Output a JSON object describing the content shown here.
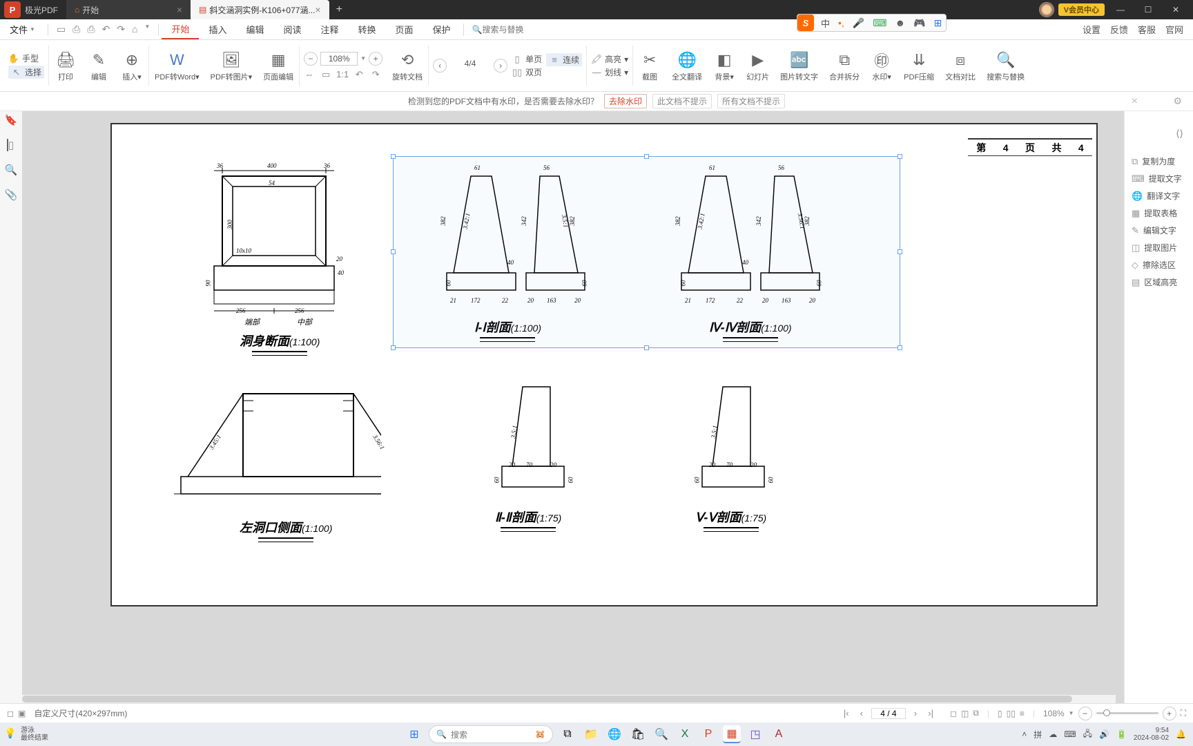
{
  "app_name": "极光PDF",
  "tabs": {
    "home_label": "开始",
    "doc_label": "斜交涵洞实例-K106+077涵..."
  },
  "vip_button": "V会员中心",
  "file_button": "文件",
  "menu": {
    "items": [
      "开始",
      "插入",
      "编辑",
      "阅读",
      "注释",
      "转换",
      "页面",
      "保护"
    ],
    "active": "开始",
    "search_placeholder": "搜索与替换",
    "right_items": [
      "设置",
      "反馈",
      "客服",
      "官网"
    ]
  },
  "ribbon": {
    "hand": "手型",
    "select": "选择",
    "print": "打印",
    "edit": "编辑",
    "insert": "插入",
    "pdf2word": "PDF转Word",
    "pdf2img": "PDF转图片",
    "page_edit": "页面编辑",
    "zoom_value": "108%",
    "page_value": "4/4",
    "rotate": "旋转文档",
    "single_page": "单页",
    "two_page": "双页",
    "continuous": "连续",
    "highlight": "高亮",
    "line": "划线",
    "screenshot": "截图",
    "fulltext_trans": "全文翻译",
    "background": "背景",
    "slideshow": "幻灯片",
    "img2text": "图片转文字",
    "merge_split": "合并拆分",
    "watermark": "水印",
    "pdf_compress": "PDF压缩",
    "doc_compare": "文档对比",
    "search_replace": "搜索与替换"
  },
  "notif": {
    "message": "检测到您的PDF文档中有水印，是否需要去除水印？",
    "action_remove": "去除水印",
    "action_hide_this": "此文档不提示",
    "action_hide_all": "所有文档不提示"
  },
  "right_panel": {
    "items": [
      {
        "icon": "⧉",
        "label": "复制为度"
      },
      {
        "icon": "⌨",
        "label": "提取文字"
      },
      {
        "icon": "🌐",
        "label": "翻译文字"
      },
      {
        "icon": "▦",
        "label": "提取表格"
      },
      {
        "icon": "✎",
        "label": "编辑文字"
      },
      {
        "icon": "◫",
        "label": "提取图片"
      },
      {
        "icon": "◇",
        "label": "擦除选区"
      },
      {
        "icon": "▤",
        "label": "区域高亮"
      }
    ]
  },
  "status": {
    "page_size": "自定义尺寸(420×297mm)",
    "page_nav": "4 / 4",
    "zoom_label": "108%"
  },
  "taskbar": {
    "assistant_title": "游泳",
    "assistant_sub": "最终结果",
    "search_placeholder": "搜索",
    "time": "9:54",
    "date": "2024-08-02"
  },
  "drawings": {
    "sec1": {
      "title": "洞身断面",
      "scale": "(1:100)",
      "dims": {
        "w_top": "400",
        "w_flange": "36",
        "h_inner": "300",
        "w_base_l": "256",
        "w_base_r": "256",
        "h_base": "90",
        "fillet": "10x10",
        "label_l": "端部",
        "label_r": "中部",
        "tf_r": "20",
        "top_thk": "54",
        "jog": "40"
      }
    },
    "sec2": {
      "title": "左洞口侧面",
      "scale": "(1:100)",
      "slope_l": "3.45:1",
      "slope_r": "3.56:1"
    },
    "sec3": {
      "title": "Ⅰ-Ⅰ剖面",
      "scale": "(1:100)",
      "dims": {
        "top_l": "61",
        "top_r": "56",
        "h": "342",
        "side_h": "382",
        "slope_l": "3.42:1",
        "slope_r": "3.5:1",
        "base_h": "60",
        "b1": "21",
        "b2": "172",
        "b3": "22",
        "c1": "20",
        "c2": "163",
        "c3": "20",
        "gap": "40"
      }
    },
    "sec4": {
      "title": "Ⅳ-Ⅳ剖面",
      "scale": "(1:100)",
      "dims": {
        "top_l": "61",
        "top_r": "56",
        "h": "342",
        "side_h": "382",
        "slope_l": "3.42:1",
        "slope_r": "3.56:1",
        "base_h": "60",
        "b1": "21",
        "b2": "172",
        "b3": "22",
        "c1": "20",
        "c2": "163",
        "c3": "20",
        "gap": "40"
      }
    },
    "sec5": {
      "title": "Ⅱ-Ⅱ剖面",
      "scale": "(1:75)",
      "dims": {
        "slope": "3.5:1",
        "w1": "20",
        "w2": "70",
        "w3": "20",
        "h_base": "60"
      }
    },
    "sec6": {
      "title": "Ⅴ-Ⅴ剖面",
      "scale": "(1:75)",
      "dims": {
        "slope": "3.5:1",
        "w1": "20",
        "w2": "70",
        "w3": "20",
        "h_base": "60"
      }
    },
    "header": {
      "c1": "第",
      "c2": "4",
      "c3": "页",
      "c4": "共",
      "c5": "4"
    }
  },
  "ime": {
    "lang": "中"
  }
}
